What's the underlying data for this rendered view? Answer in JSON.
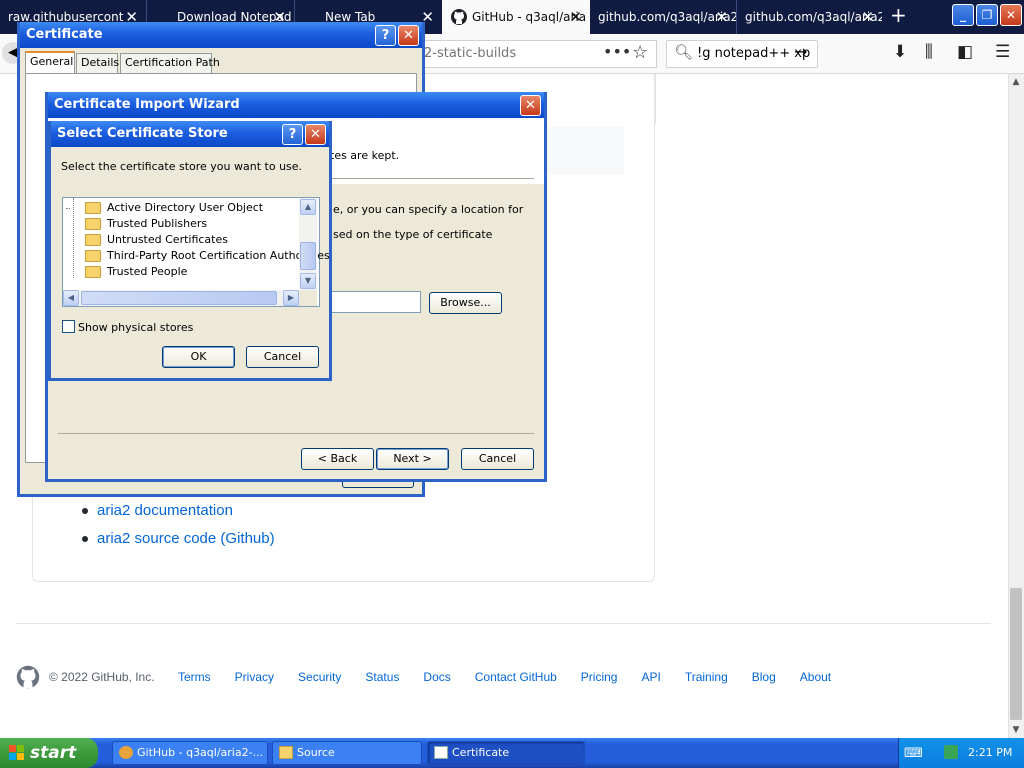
{
  "browser": {
    "tabs": [
      {
        "label": "raw.githubusercont",
        "active": false
      },
      {
        "label": "Download Notepad",
        "active": false
      },
      {
        "label": "New Tab",
        "active": false
      },
      {
        "label": "GitHub - q3aql/aria",
        "active": true
      },
      {
        "label": "github.com/q3aql/aria2",
        "active": false
      },
      {
        "label": "github.com/q3aql/aria2",
        "active": false
      }
    ],
    "new_tab_symbol": "+",
    "url_text": "2-static-builds",
    "search_text": "!g notepad++ xp",
    "more_symbol": "•••"
  },
  "page": {
    "doc_links": [
      "aria2 documentation",
      "aria2 source code (Github)"
    ],
    "copyright": "© 2022 GitHub, Inc.",
    "footer_links": [
      "Terms",
      "Privacy",
      "Security",
      "Status",
      "Docs",
      "Contact GitHub",
      "Pricing",
      "API",
      "Training",
      "Blog",
      "About"
    ]
  },
  "certificate_window": {
    "title": "Certificate",
    "help": "?",
    "close": "✕",
    "tabs": [
      "General",
      "Details",
      "Certification Path"
    ]
  },
  "import_wizard": {
    "title": "Certificate Import Wizard",
    "close": "✕",
    "text_kept": "tes are kept.",
    "text_location": "e, or you can specify a location for",
    "text_type": "sed on the type of certificate",
    "browse": "Browse...",
    "back": "< Back",
    "next": "Next >",
    "cancel": "Cancel"
  },
  "select_store": {
    "title": "Select Certificate Store",
    "help": "?",
    "close": "✕",
    "instruction": "Select the certificate store you want to use.",
    "stores": [
      "Active Directory User Object",
      "Trusted Publishers",
      "Untrusted Certificates",
      "Third-Party Root Certification Authorities",
      "Trusted People"
    ],
    "show_physical": "Show physical stores",
    "ok": "OK",
    "cancel": "Cancel"
  },
  "taskbar": {
    "start": "start",
    "tasks": [
      "GitHub - q3aql/aria2-...",
      "Source",
      "Certificate"
    ],
    "clock": "2:21 PM"
  }
}
